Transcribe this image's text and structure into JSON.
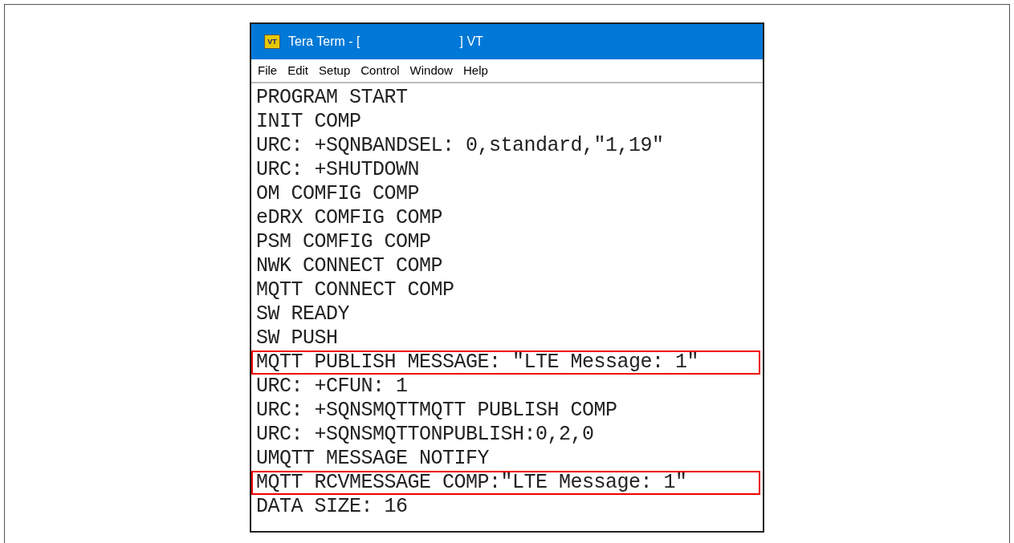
{
  "window": {
    "title_start": "Tera Term - [",
    "title_end": "] VT",
    "icon_text": "VT"
  },
  "menu": [
    "File",
    "Edit",
    "Setup",
    "Control",
    "Window",
    "Help"
  ],
  "terminal_lines": [
    {
      "text": "PROGRAM START",
      "highlighted": false
    },
    {
      "text": "INIT COMP",
      "highlighted": false
    },
    {
      "text": "URC: +SQNBANDSEL: 0,standard,\"1,19\"",
      "highlighted": false
    },
    {
      "text": "URC: +SHUTDOWN",
      "highlighted": false
    },
    {
      "text": "OM COMFIG COMP",
      "highlighted": false
    },
    {
      "text": "eDRX COMFIG COMP",
      "highlighted": false
    },
    {
      "text": "PSM COMFIG COMP",
      "highlighted": false
    },
    {
      "text": "NWK CONNECT COMP",
      "highlighted": false
    },
    {
      "text": "MQTT CONNECT COMP",
      "highlighted": false
    },
    {
      "text": "SW READY",
      "highlighted": false
    },
    {
      "text": "SW PUSH",
      "highlighted": false
    },
    {
      "text": "MQTT PUBLISH MESSAGE: \"LTE Message: 1\"",
      "highlighted": true
    },
    {
      "text": "URC: +CFUN: 1",
      "highlighted": false
    },
    {
      "text": "URC: +SQNSMQTTMQTT PUBLISH COMP",
      "highlighted": false
    },
    {
      "text": "URC: +SQNSMQTTONPUBLISH:0,2,0",
      "highlighted": false
    },
    {
      "text": "UMQTT MESSAGE NOTIFY",
      "highlighted": false
    },
    {
      "text": "MQTT RCVMESSAGE COMP:\"LTE Message: 1\"",
      "highlighted": true
    },
    {
      "text": "DATA SIZE: 16",
      "highlighted": false
    }
  ]
}
